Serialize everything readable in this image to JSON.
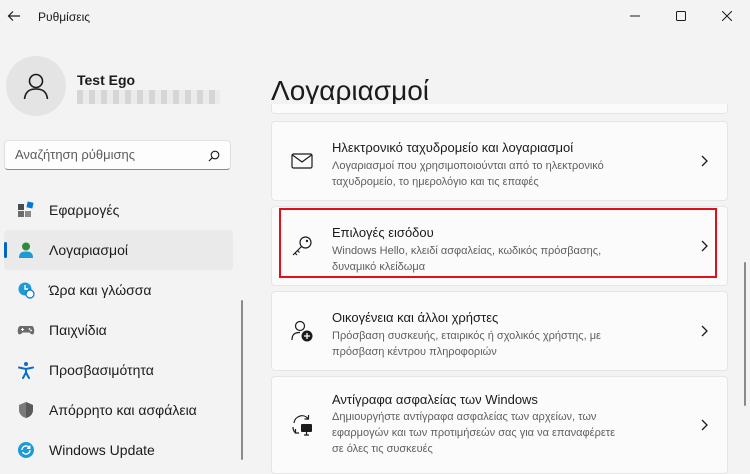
{
  "window": {
    "title": "Ρυθμίσεις"
  },
  "user": {
    "name": "Test Ego"
  },
  "search": {
    "placeholder": "Αναζήτηση ρύθμισης"
  },
  "sidebar": {
    "items": [
      {
        "label": "Εφαρμογές",
        "icon": "apps-icon"
      },
      {
        "label": "Λογαριασμοί",
        "icon": "accounts-icon",
        "active": true
      },
      {
        "label": "Ώρα και γλώσσα",
        "icon": "time-language-icon"
      },
      {
        "label": "Παιχνίδια",
        "icon": "gaming-icon"
      },
      {
        "label": "Προσβασιμότητα",
        "icon": "accessibility-icon"
      },
      {
        "label": "Απόρρητο και ασφάλεια",
        "icon": "shield-icon"
      },
      {
        "label": "Windows Update",
        "icon": "windows-update-icon"
      }
    ]
  },
  "main": {
    "title": "Λογαριασμοί",
    "cards": [
      {
        "title": "Ηλεκτρονικό ταχυδρομείο και λογαριασμοί",
        "desc1": "Λογαριασμοί που χρησιμοποιούνται από το ηλεκτρονικό",
        "desc2": "ταχυδρομείο, το ημερολόγιο και τις επαφές",
        "icon": "mail-icon"
      },
      {
        "title": "Επιλογές εισόδου",
        "desc1": "Windows Hello, κλειδί ασφαλείας, κωδικός πρόσβασης,",
        "desc2": "δυναμικό κλείδωμα",
        "icon": "key-icon"
      },
      {
        "title": "Οικογένεια και άλλοι χρήστες",
        "desc1": "Πρόσβαση συσκευής, εταιρικός ή σχολικός χρήστης, με",
        "desc2": "πρόσβαση κέντρου πληροφοριών",
        "icon": "add-person-icon"
      },
      {
        "title": "Αντίγραφα ασφαλείας των Windows",
        "desc1": "Δημιουργήστε αντίγραφα ασφαλείας των αρχείων, των",
        "desc2": "εφαρμογών και των προτιμήσεών σας για να επαναφέρετε",
        "desc3": "σε όλες τις συσκευές",
        "icon": "backup-icon"
      }
    ]
  },
  "colors": {
    "accent": "#0067c0",
    "highlight": "#e0101a",
    "background": "#f3f3f3"
  }
}
